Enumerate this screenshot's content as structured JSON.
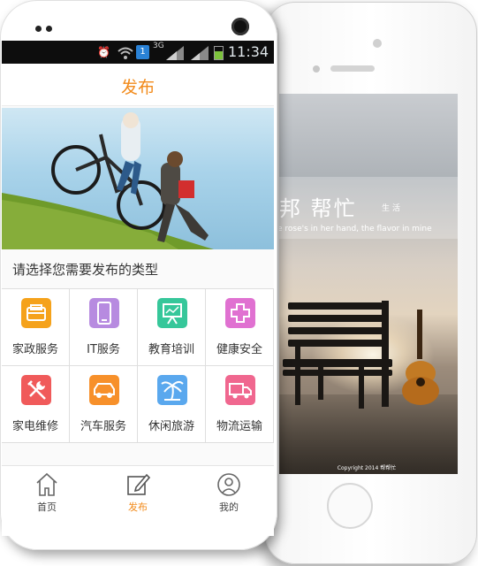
{
  "status_bar": {
    "network": "3G",
    "notification_badge": "1",
    "time": "11:34",
    "icons": [
      "alarm-icon",
      "wifi-icon",
      "notification-icon",
      "signal-icon",
      "signal-icon",
      "battery-icon"
    ]
  },
  "header": {
    "title": "发布"
  },
  "prompt": "请选择您需要发布的类型",
  "categories": [
    {
      "label": "家政服务",
      "icon": "housekeeping-icon",
      "color": "#f5a21b"
    },
    {
      "label": "IT服务",
      "icon": "phone-icon",
      "color": "#b78be0"
    },
    {
      "label": "教育培训",
      "icon": "presentation-icon",
      "color": "#36c79a"
    },
    {
      "label": "健康安全",
      "icon": "medical-cross-icon",
      "color": "#e071d1"
    },
    {
      "label": "家电维修",
      "icon": "repair-icon",
      "color": "#f05a5a"
    },
    {
      "label": "汽车服务",
      "icon": "car-icon",
      "color": "#f7902a"
    },
    {
      "label": "休闲旅游",
      "icon": "palm-tree-icon",
      "color": "#5aa8ee"
    },
    {
      "label": "物流运输",
      "icon": "truck-icon",
      "color": "#f0678f"
    }
  ],
  "tabs": [
    {
      "label": "首页",
      "icon": "home-icon",
      "active": false
    },
    {
      "label": "发布",
      "icon": "edit-icon",
      "active": true
    },
    {
      "label": "我的",
      "icon": "user-icon",
      "active": false
    }
  ],
  "splash": {
    "brand": "帮忙",
    "brand_prefix": "邦",
    "brand_suffix": "生活",
    "tagline": "e rose's in her hand, the flavor in mine",
    "copyright": "Copyright 2014 帮帮忙"
  },
  "colors": {
    "accent": "#f28a1a"
  }
}
